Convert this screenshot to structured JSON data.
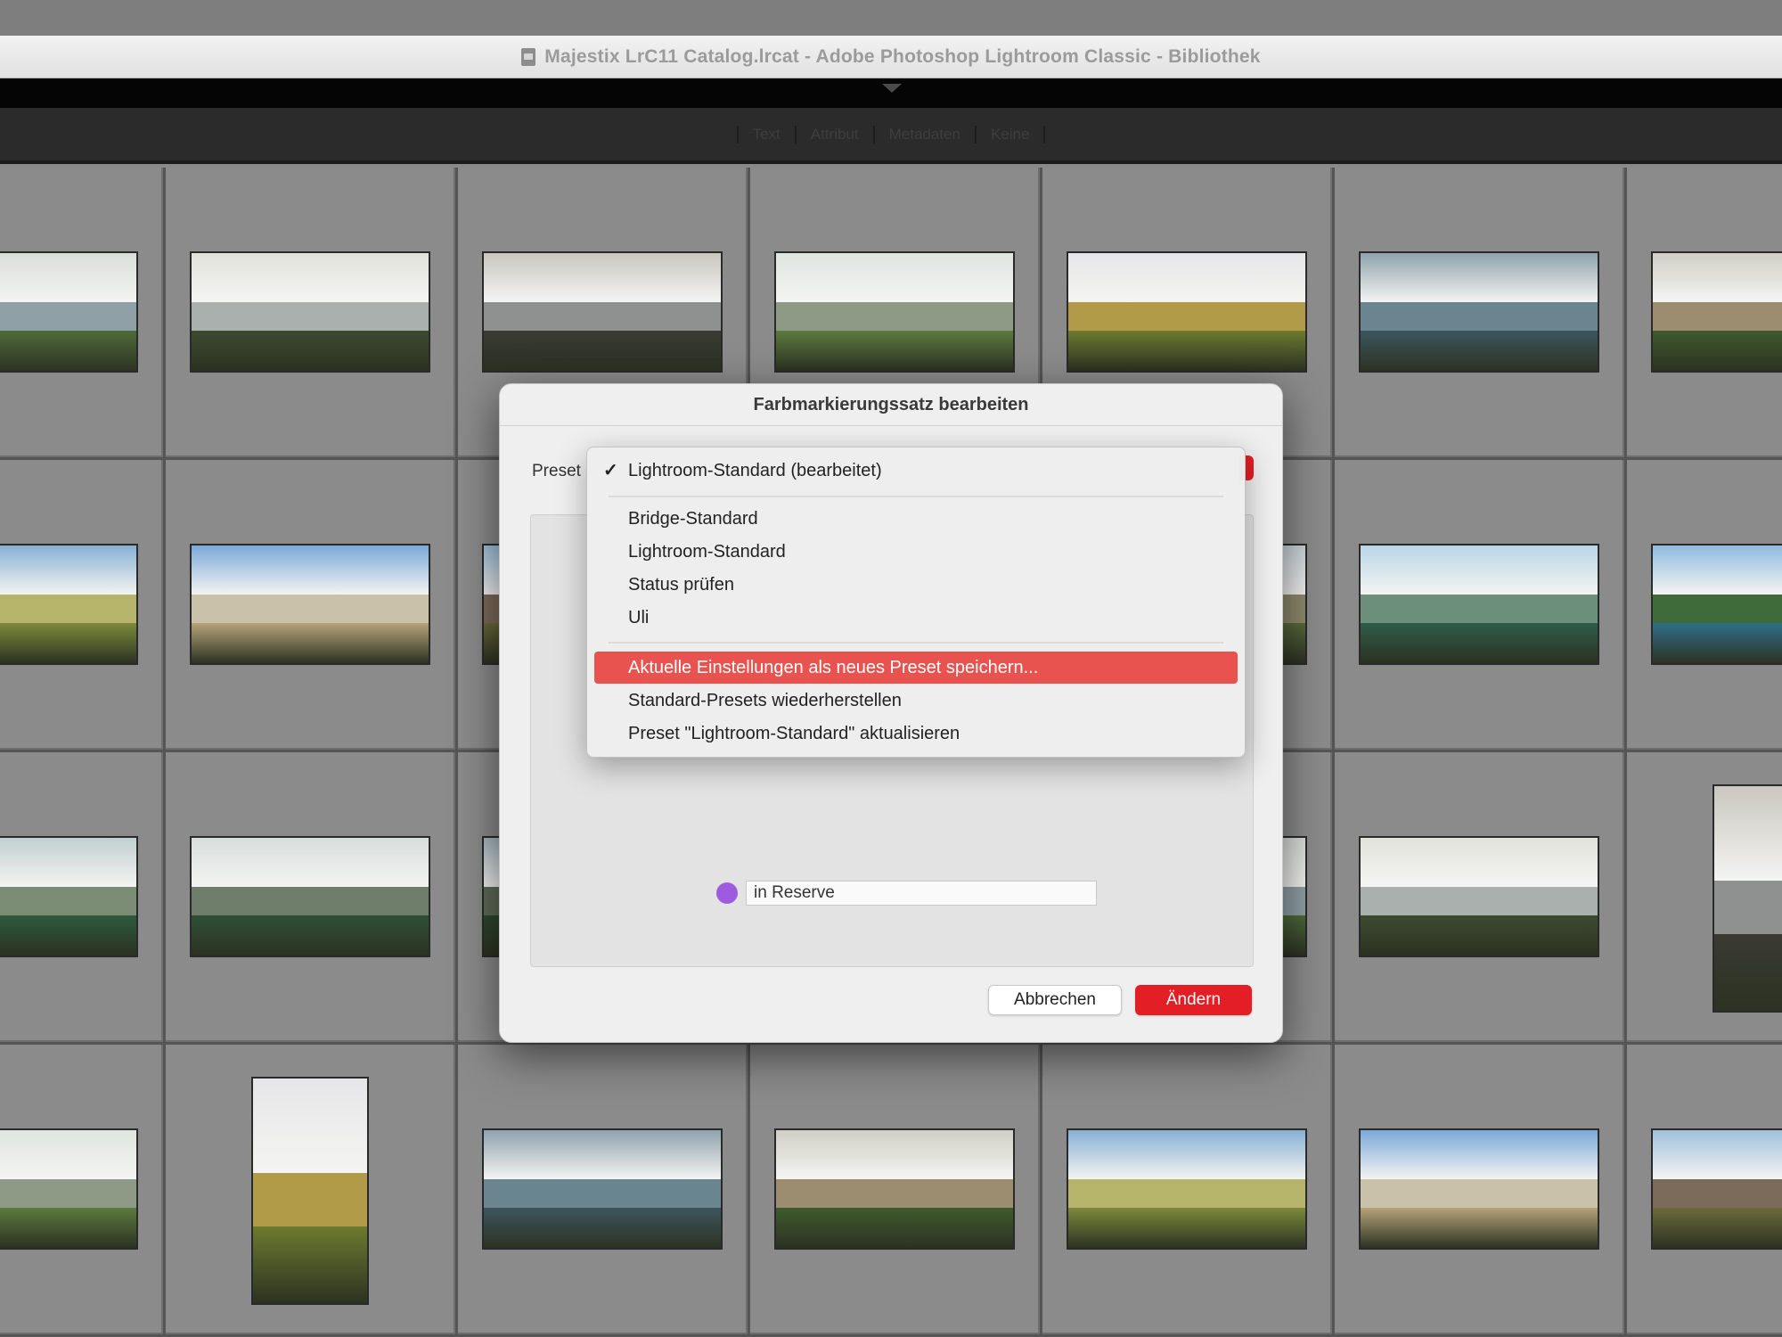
{
  "window": {
    "title": "Majestix LrC11 Catalog.lrcat - Adobe Photoshop Lightroom Classic - Bibliothek"
  },
  "filter_bar": {
    "items": [
      "Text",
      "Attribut",
      "Metadaten",
      "Keine"
    ]
  },
  "dialog": {
    "title": "Farbmarkierungssatz bearbeiten",
    "preset_label": "Preset",
    "label_row_7": {
      "text": "in Reserve",
      "color": "#9d5ce0"
    },
    "cancel_label": "Abbrechen",
    "change_label": "Ändern"
  },
  "preset_menu": {
    "selected": "Lightroom-Standard (bearbeitet)",
    "presets": [
      "Bridge-Standard",
      "Lightroom-Standard",
      "Status prüfen",
      "Uli"
    ],
    "actions": [
      "Aktuelle Einstellungen als neues Preset speichern...",
      "Standard-Presets wiederherstellen",
      "Preset \"Lightroom-Standard\" aktualisieren"
    ],
    "highlighted_action": 0
  },
  "colors": {
    "accent_red": "#e31e24",
    "menu_highlight": "#e8534f",
    "grid_cell": "#8b8b8b"
  }
}
